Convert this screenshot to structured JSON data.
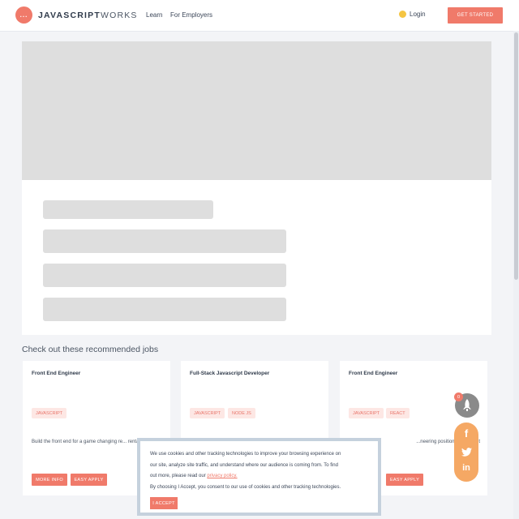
{
  "header": {
    "logo_mark": "...",
    "logo_bold": "JAVASCRIPT",
    "logo_light": "WORKS",
    "nav": {
      "learn": "Learn",
      "employers": "For Employers"
    },
    "login": "Login",
    "cta": "GET STARTED"
  },
  "recommended": {
    "title": "Check out these recommended jobs",
    "jobs": [
      {
        "title": "Front End Engineer",
        "tags": [
          "JAVASCRIPT"
        ],
        "description": "Build the front end for a game changing re... rental platform",
        "more_info": "MORE INFO",
        "easy_apply": "EASY APPLY"
      },
      {
        "title": "Full-Stack Javascript Developer",
        "tags": [
          "JAVASCRIPT",
          "NODE JS"
        ],
        "description": "",
        "more_info": "",
        "easy_apply": ""
      },
      {
        "title": "Front End Engineer",
        "tags": [
          "JAVASCRIPT",
          "REACT"
        ],
        "description": "...neering position at a decent",
        "more_info": "",
        "easy_apply": "EASY APPLY"
      }
    ]
  },
  "floating": {
    "rocket_badge": "0"
  },
  "cookie": {
    "line1": "We use cookies and other tracking technologies to improve your browsing experience on",
    "line2": "our site, analyze site traffic, and understand where our audience is coming from. To find",
    "line3_prefix": "out more, please read our ",
    "link": "privacy policy.",
    "line4": "By choosing I Accept, you consent to our use of cookies and other tracking technologies.",
    "accept": "I ACCEPT"
  },
  "colors": {
    "accent": "#f07a6a",
    "social": "#f5a864",
    "skeleton": "#dedede"
  }
}
